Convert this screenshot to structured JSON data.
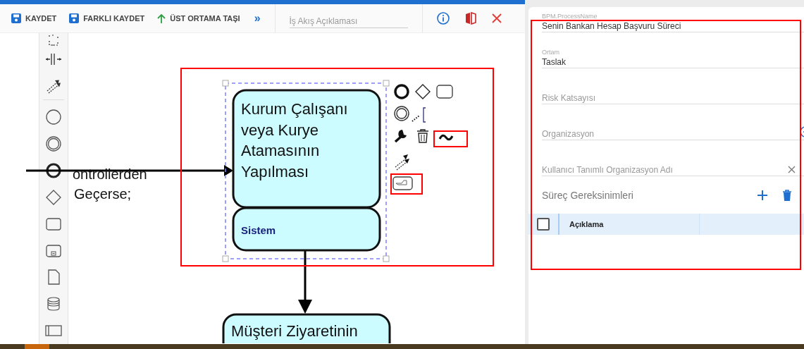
{
  "toolbar": {
    "actions": [
      {
        "kind": "save",
        "label": "KAYDET"
      },
      {
        "kind": "save-as",
        "label": "FARKLI KAYDET"
      },
      {
        "kind": "move-up",
        "label": "ÜST ORTAMA TAŞI"
      },
      {
        "kind": "more",
        "label": "»"
      }
    ],
    "description_field": {
      "placeholder": "İş Akış Açıklaması"
    }
  },
  "diagram": {
    "flow_label": [
      "ontrollerden",
      "Geçerse;"
    ],
    "tasks": [
      {
        "lines": [
          "Kurum Çalışanı",
          "veya Kurye",
          "Atamasının",
          "Yapılması"
        ],
        "lane": "Sistem",
        "selected": true
      },
      {
        "lines": [
          "Müşteri Ziyaretinin"
        ],
        "selected": false
      }
    ]
  },
  "properties": {
    "highlighted": true,
    "fields": [
      {
        "kind": "text",
        "label": "BPM.ProcessName",
        "value": "Senin Bankan Hesap Başvuru Süreci"
      },
      {
        "kind": "text",
        "label": "Ortam",
        "value": "Taslak"
      },
      {
        "kind": "text",
        "placeholder": "Risk Katsayısı"
      },
      {
        "kind": "lookup",
        "placeholder": "Organizasyon"
      },
      {
        "kind": "clearable",
        "placeholder": "Kullanıcı Tanımlı Organizasyon Adı"
      }
    ],
    "requirements": {
      "title": "Süreç Gereksinimleri",
      "select_all": {
        "checked": false
      },
      "columns": [
        "Açıklama"
      ]
    }
  }
}
